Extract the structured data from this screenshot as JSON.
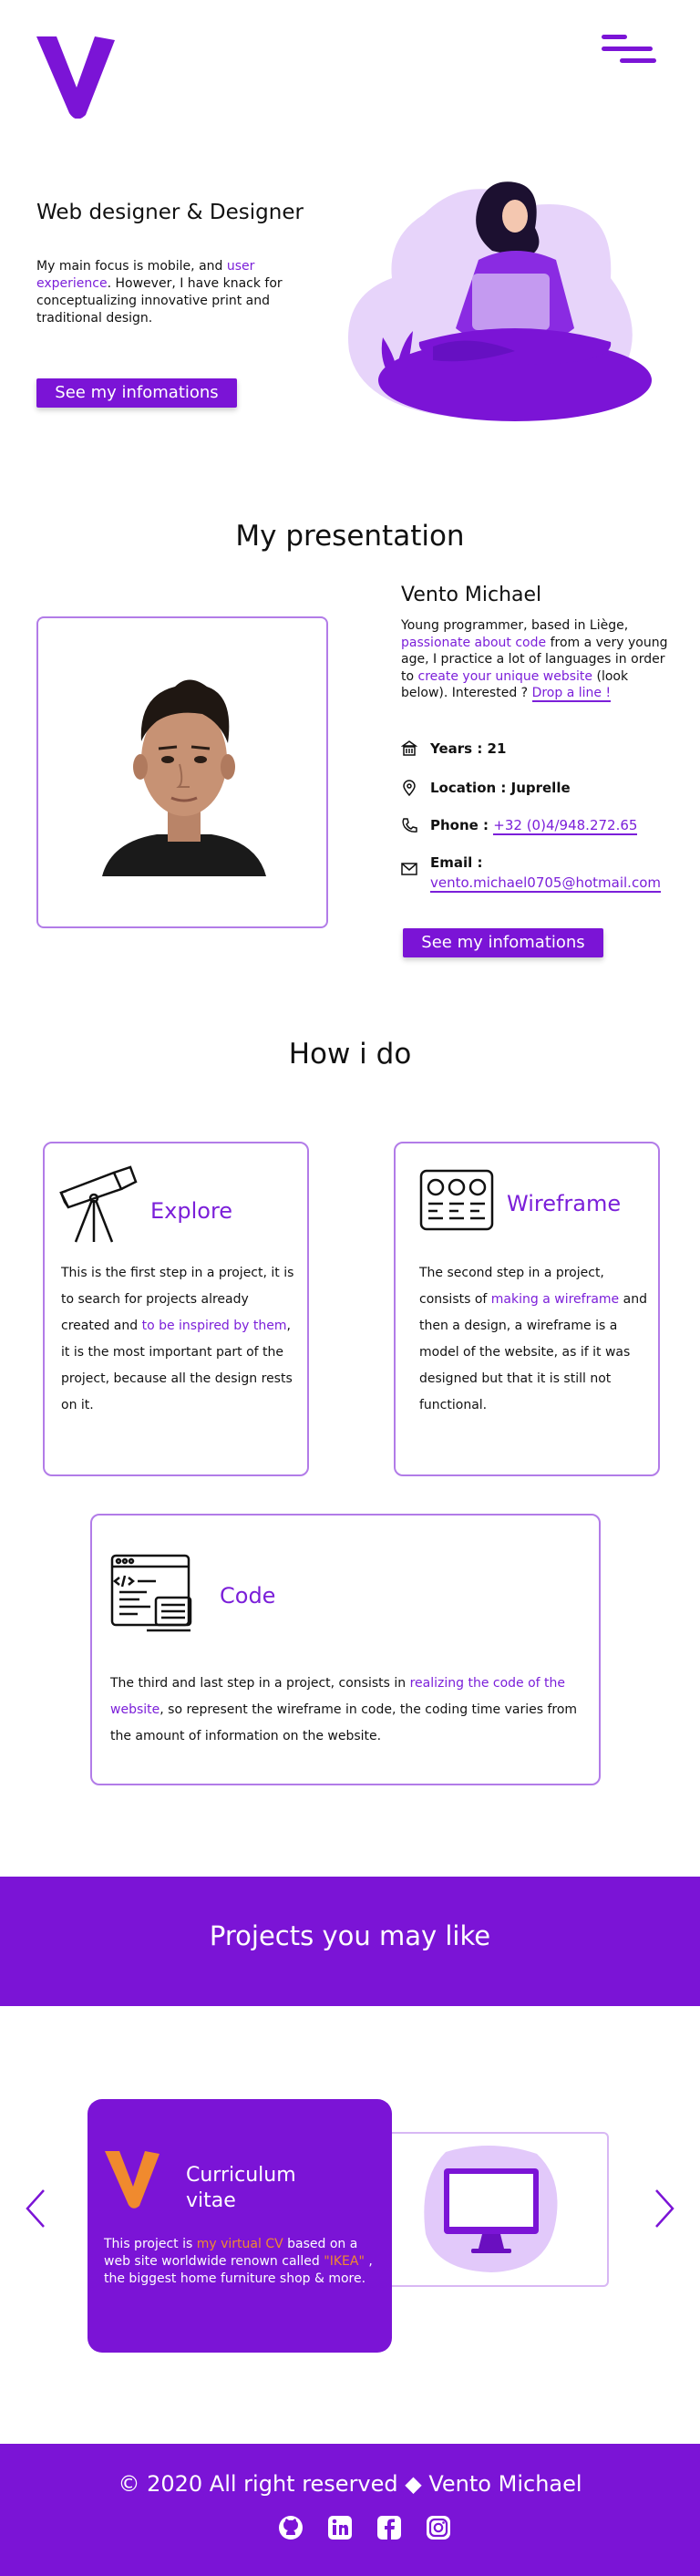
{
  "header": {
    "logo_icon": "v-logo-icon",
    "menu_icon": "hamburger-menu-icon"
  },
  "hero": {
    "title": "Web designer & Designer",
    "text_1": "My main focus is mobile, and ",
    "text_highlight": "user experience",
    "text_2": ". However, I have knack for conceptualizing innovative print and traditional design.",
    "button_label": "See my infomations",
    "illustration": "woman-with-laptop-illustration"
  },
  "presentation": {
    "title": "My presentation",
    "name": "Vento Michael",
    "bio_1": "Young programmer, based in Liège, ",
    "bio_hl_1": "passionate about code",
    "bio_2": " from a very young age, I practice a lot of languages in order to ",
    "bio_hl_2": "create your unique website",
    "bio_3": " (look below). Interested ? ",
    "bio_link": "Drop a line !",
    "years_label": "Years : 21",
    "location_label": "Location : Juprelle",
    "phone_label": "Phone : ",
    "phone_value": "+32 (0)4/948.272.65",
    "email_label": "Email :",
    "email_value": "vento.michael0705@hotmail.com",
    "button_label": "See my infomations",
    "photo": "portrait-photo"
  },
  "how": {
    "title": "How i do",
    "explore": {
      "title": "Explore",
      "text_1": "This is the first step in a project, it is to search for projects already created and ",
      "text_hl": "to be inspired by them",
      "text_2": ", it is the most important part of the project, because all the design rests on it.",
      "icon": "telescope-icon"
    },
    "wireframe": {
      "title": "Wireframe",
      "text_1": "The second step in a project, consists of ",
      "text_hl": "making a wireframe",
      "text_2": " and then a design, a wireframe is a model of the website, as if it was designed but that it is still not functional.",
      "icon": "wireframe-icon"
    },
    "code": {
      "title": "Code",
      "text_1": "The third and last step in a project, consists in ",
      "text_hl": "realizing the code of the website",
      "text_2": ", so represent the wireframe in code, the coding time varies from the amount of information on the website.",
      "icon": "code-window-icon"
    }
  },
  "projects": {
    "title": "Projects you may like",
    "card_title": "Curriculum vitae",
    "text_1": "This project is ",
    "text_hl_1": "my virtual CV",
    "text_2": "  based on a web site worldwide renown called ",
    "text_hl_2": "\"IKEA\"",
    "text_3": " , the biggest home furniture shop & more.",
    "prev_icon": "chevron-left-icon",
    "next_icon": "chevron-right-icon",
    "preview": "monitor-illustration"
  },
  "footer": {
    "copyright": "© 2020 All right reserved ",
    "author": " Vento Michael",
    "diamond_icon": "diamond-icon",
    "icons": [
      "github-icon",
      "linkedin-icon",
      "facebook-icon",
      "instagram-icon"
    ]
  },
  "colors": {
    "accent": "#7b14d6",
    "accent_light": "#b27ce8",
    "highlight_orange": "#f08a2e"
  }
}
